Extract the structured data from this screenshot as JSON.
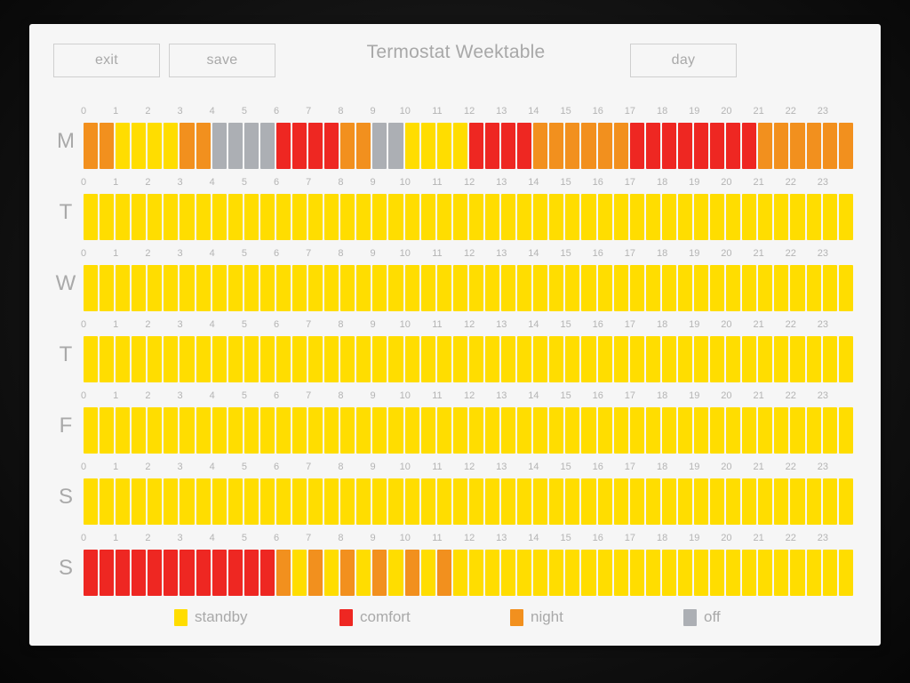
{
  "app": {
    "title": "Termostat Weektable",
    "background_color": "#0b0b0b",
    "panel_color": "#f6f6f6"
  },
  "toolbar": {
    "exit_label": "exit",
    "save_label": "save",
    "day_label": "day"
  },
  "modes": {
    "standby": {
      "label": "standby",
      "color": "#FFDD00"
    },
    "comfort": {
      "label": "comfort",
      "color": "#EE2722"
    },
    "night": {
      "label": "night",
      "color": "#F2901E"
    },
    "off": {
      "label": "off",
      "color": "#ACAFB4"
    }
  },
  "legend": [
    {
      "key": "standby",
      "label": "standby",
      "color": "#FFDD00"
    },
    {
      "key": "comfort",
      "label": "comfort",
      "color": "#EE2722"
    },
    {
      "key": "night",
      "label": "night",
      "color": "#F2901E"
    },
    {
      "key": "off",
      "label": "off",
      "color": "#ACAFB4"
    }
  ],
  "grid": {
    "hours": [
      0,
      1,
      2,
      3,
      4,
      5,
      6,
      7,
      8,
      9,
      10,
      11,
      12,
      13,
      14,
      15,
      16,
      17,
      18,
      19,
      20,
      21,
      22,
      23
    ],
    "slots_per_hour": 2,
    "slot_minutes": 30,
    "total_slots": 48
  },
  "days": [
    {
      "label": "M",
      "name": "monday",
      "slots": [
        "night",
        "night",
        "standby",
        "standby",
        "standby",
        "standby",
        "night",
        "night",
        "off",
        "off",
        "off",
        "off",
        "comfort",
        "comfort",
        "comfort",
        "comfort",
        "night",
        "night",
        "off",
        "off",
        "standby",
        "standby",
        "standby",
        "standby",
        "comfort",
        "comfort",
        "comfort",
        "comfort",
        "night",
        "night",
        "night",
        "night",
        "night",
        "night",
        "comfort",
        "comfort",
        "comfort",
        "comfort",
        "comfort",
        "comfort",
        "comfort",
        "comfort",
        "night",
        "night",
        "night",
        "night",
        "night",
        "night"
      ]
    },
    {
      "label": "T",
      "name": "tuesday",
      "slots": [
        "standby",
        "standby",
        "standby",
        "standby",
        "standby",
        "standby",
        "standby",
        "standby",
        "standby",
        "standby",
        "standby",
        "standby",
        "standby",
        "standby",
        "standby",
        "standby",
        "standby",
        "standby",
        "standby",
        "standby",
        "standby",
        "standby",
        "standby",
        "standby",
        "standby",
        "standby",
        "standby",
        "standby",
        "standby",
        "standby",
        "standby",
        "standby",
        "standby",
        "standby",
        "standby",
        "standby",
        "standby",
        "standby",
        "standby",
        "standby",
        "standby",
        "standby",
        "standby",
        "standby",
        "standby",
        "standby",
        "standby",
        "standby"
      ]
    },
    {
      "label": "W",
      "name": "wednesday",
      "slots": [
        "standby",
        "standby",
        "standby",
        "standby",
        "standby",
        "standby",
        "standby",
        "standby",
        "standby",
        "standby",
        "standby",
        "standby",
        "standby",
        "standby",
        "standby",
        "standby",
        "standby",
        "standby",
        "standby",
        "standby",
        "standby",
        "standby",
        "standby",
        "standby",
        "standby",
        "standby",
        "standby",
        "standby",
        "standby",
        "standby",
        "standby",
        "standby",
        "standby",
        "standby",
        "standby",
        "standby",
        "standby",
        "standby",
        "standby",
        "standby",
        "standby",
        "standby",
        "standby",
        "standby",
        "standby",
        "standby",
        "standby",
        "standby"
      ]
    },
    {
      "label": "T",
      "name": "thursday",
      "slots": [
        "standby",
        "standby",
        "standby",
        "standby",
        "standby",
        "standby",
        "standby",
        "standby",
        "standby",
        "standby",
        "standby",
        "standby",
        "standby",
        "standby",
        "standby",
        "standby",
        "standby",
        "standby",
        "standby",
        "standby",
        "standby",
        "standby",
        "standby",
        "standby",
        "standby",
        "standby",
        "standby",
        "standby",
        "standby",
        "standby",
        "standby",
        "standby",
        "standby",
        "standby",
        "standby",
        "standby",
        "standby",
        "standby",
        "standby",
        "standby",
        "standby",
        "standby",
        "standby",
        "standby",
        "standby",
        "standby",
        "standby",
        "standby"
      ]
    },
    {
      "label": "F",
      "name": "friday",
      "slots": [
        "standby",
        "standby",
        "standby",
        "standby",
        "standby",
        "standby",
        "standby",
        "standby",
        "standby",
        "standby",
        "standby",
        "standby",
        "standby",
        "standby",
        "standby",
        "standby",
        "standby",
        "standby",
        "standby",
        "standby",
        "standby",
        "standby",
        "standby",
        "standby",
        "standby",
        "standby",
        "standby",
        "standby",
        "standby",
        "standby",
        "standby",
        "standby",
        "standby",
        "standby",
        "standby",
        "standby",
        "standby",
        "standby",
        "standby",
        "standby",
        "standby",
        "standby",
        "standby",
        "standby",
        "standby",
        "standby",
        "standby",
        "standby"
      ]
    },
    {
      "label": "S",
      "name": "saturday",
      "slots": [
        "standby",
        "standby",
        "standby",
        "standby",
        "standby",
        "standby",
        "standby",
        "standby",
        "standby",
        "standby",
        "standby",
        "standby",
        "standby",
        "standby",
        "standby",
        "standby",
        "standby",
        "standby",
        "standby",
        "standby",
        "standby",
        "standby",
        "standby",
        "standby",
        "standby",
        "standby",
        "standby",
        "standby",
        "standby",
        "standby",
        "standby",
        "standby",
        "standby",
        "standby",
        "standby",
        "standby",
        "standby",
        "standby",
        "standby",
        "standby",
        "standby",
        "standby",
        "standby",
        "standby",
        "standby",
        "standby",
        "standby",
        "standby"
      ]
    },
    {
      "label": "S",
      "name": "sunday",
      "slots": [
        "comfort",
        "comfort",
        "comfort",
        "comfort",
        "comfort",
        "comfort",
        "comfort",
        "comfort",
        "comfort",
        "comfort",
        "comfort",
        "comfort",
        "night",
        "standby",
        "night",
        "standby",
        "night",
        "standby",
        "night",
        "standby",
        "night",
        "standby",
        "night",
        "standby",
        "standby",
        "standby",
        "standby",
        "standby",
        "standby",
        "standby",
        "standby",
        "standby",
        "standby",
        "standby",
        "standby",
        "standby",
        "standby",
        "standby",
        "standby",
        "standby",
        "standby",
        "standby",
        "standby",
        "standby",
        "standby",
        "standby",
        "standby",
        "standby"
      ]
    }
  ]
}
